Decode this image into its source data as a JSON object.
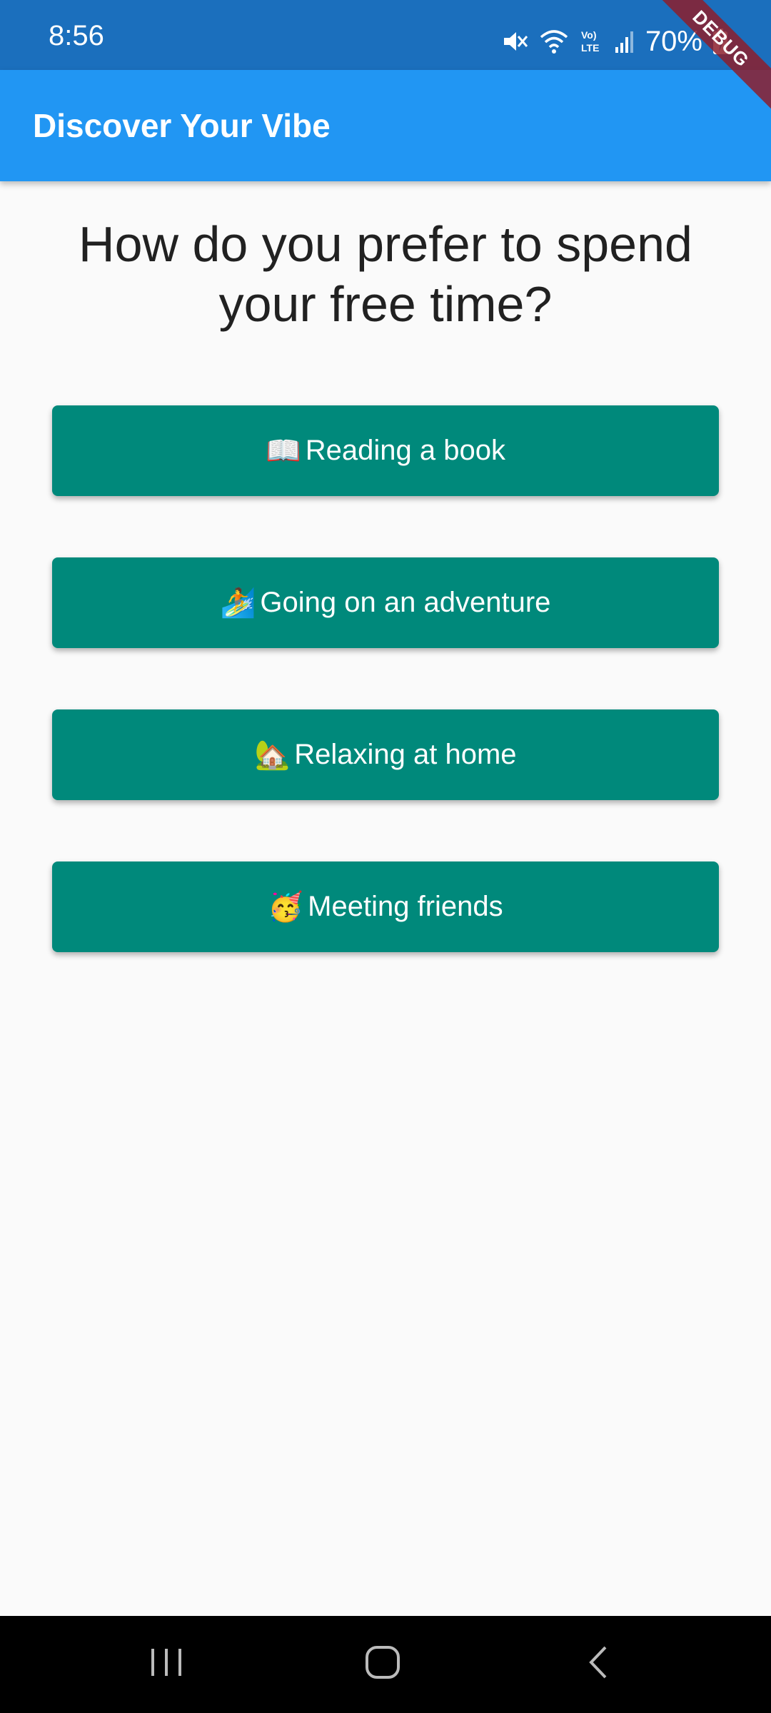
{
  "status_bar": {
    "time": "8:56",
    "battery": "70%",
    "icons": [
      "mute-icon",
      "wifi-icon",
      "volte-icon",
      "signal-icon",
      "battery-charging-icon"
    ]
  },
  "debug_banner": "DEBUG",
  "app_bar": {
    "title": "Discover Your Vibe"
  },
  "question": "How do you prefer to spend your free time?",
  "options": [
    {
      "emoji": "📖",
      "label": "Reading a book"
    },
    {
      "emoji": "🏄",
      "label": "Going on an adventure"
    },
    {
      "emoji": "🏡",
      "label": "Relaxing at home"
    },
    {
      "emoji": "🥳",
      "label": "Meeting friends"
    }
  ],
  "nav_bar": {
    "icons": [
      "recent-apps-icon",
      "home-icon",
      "back-icon"
    ]
  },
  "colors": {
    "status_bar": "#1b6fbd",
    "app_bar": "#2196f3",
    "button": "#00897b",
    "background": "#fafafa"
  }
}
